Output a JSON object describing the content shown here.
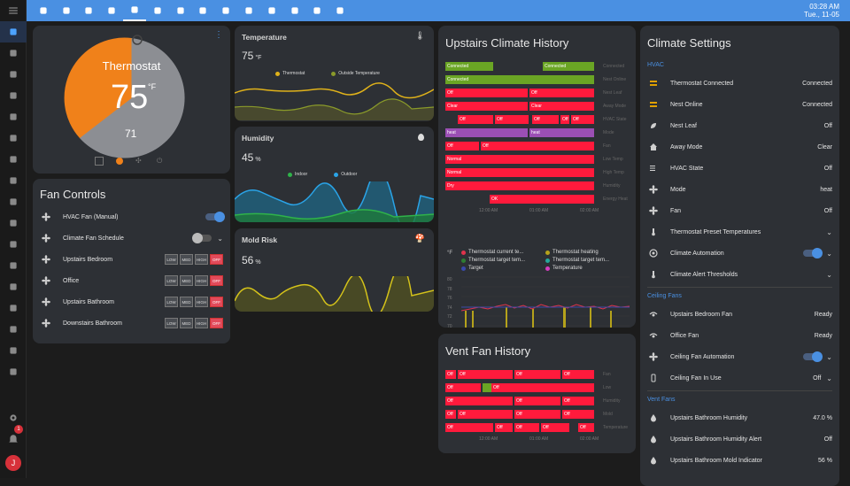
{
  "clock": {
    "time": "03:28 AM",
    "date": "Tue., 11-05"
  },
  "thermostat": {
    "name": "Thermostat",
    "target": "75",
    "unit": "°F",
    "current": "71"
  },
  "sensors": {
    "temperature": {
      "title": "Temperature",
      "value": "75",
      "unit": "°F",
      "legend": [
        "Thermostat",
        "Outside Temperature"
      ]
    },
    "humidity": {
      "title": "Humidity",
      "value": "45",
      "unit": "%",
      "legend": [
        "Indoor",
        "Outdoor"
      ]
    },
    "mold": {
      "title": "Mold Risk",
      "value": "56",
      "unit": "%"
    }
  },
  "fan_controls": {
    "title": "Fan Controls",
    "rows": [
      {
        "name": "HVAC Fan (Manual)",
        "type": "toggle",
        "on": true
      },
      {
        "name": "Climate Fan Schedule",
        "type": "toggle-chev",
        "on": false
      },
      {
        "name": "Upstairs Bedroom",
        "type": "speed"
      },
      {
        "name": "Office",
        "type": "speed"
      },
      {
        "name": "Upstairs Bathroom",
        "type": "speed"
      },
      {
        "name": "Downstairs Bathroom",
        "type": "speed"
      }
    ],
    "speeds": [
      "LOW",
      "MED",
      "HIGH",
      "OFF"
    ]
  },
  "upstairs_history": {
    "title": "Upstairs Climate History",
    "rows": [
      {
        "label": "Connected",
        "color": "#6aa524",
        "bars": [
          {
            "t": "Connected",
            "x": 0,
            "w": 54
          },
          {
            "t": "Connected",
            "x": 110,
            "w": 58
          }
        ]
      },
      {
        "label": "Nest Online",
        "color": "#6aa524",
        "bars": [
          {
            "t": "Connected",
            "x": 0,
            "w": 168
          }
        ]
      },
      {
        "label": "Nest Leaf",
        "color": "#ff1a3c",
        "bars": [
          {
            "t": "Off",
            "x": 0,
            "w": 93
          },
          {
            "t": "Off",
            "x": 95,
            "w": 73
          }
        ]
      },
      {
        "label": "Away Mode",
        "color": "#ff1a3c",
        "bars": [
          {
            "t": "Clear",
            "x": 0,
            "w": 93
          },
          {
            "t": "Clear",
            "x": 95,
            "w": 73
          }
        ]
      },
      {
        "label": "HVAC State",
        "color": "#ff1a3c",
        "bars": [
          {
            "t": "Off",
            "x": 14,
            "w": 40
          },
          {
            "t": "Off",
            "x": 56,
            "w": 38
          },
          {
            "t": "Off",
            "x": 98,
            "w": 30
          },
          {
            "t": "Off",
            "x": 130,
            "w": 10
          },
          {
            "t": "Off",
            "x": 142,
            "w": 26
          }
        ]
      },
      {
        "label": "Mode",
        "color": "#9b4fb4",
        "bars": [
          {
            "t": "heat",
            "x": 0,
            "w": 93
          },
          {
            "t": "heat",
            "x": 95,
            "w": 73
          }
        ]
      },
      {
        "label": "Fan",
        "color": "#ff1a3c",
        "bars": [
          {
            "t": "Off",
            "x": 0,
            "w": 38
          },
          {
            "t": "Off",
            "x": 40,
            "w": 128
          }
        ]
      },
      {
        "label": "Low Temp",
        "color": "#ff1a3c",
        "bars": [
          {
            "t": "Normal",
            "x": 0,
            "w": 168
          }
        ]
      },
      {
        "label": "High Temp",
        "color": "#ff1a3c",
        "bars": [
          {
            "t": "Normal",
            "x": 0,
            "w": 168
          }
        ]
      },
      {
        "label": "Humidity",
        "color": "#ff1a3c",
        "bars": [
          {
            "t": "Dry",
            "x": 0,
            "w": 168
          }
        ]
      },
      {
        "label": "Energy Heat",
        "color": "#ff1a3c",
        "bars": [
          {
            "t": "OK",
            "x": 50,
            "w": 118
          }
        ]
      }
    ],
    "times": [
      "12:00 AM",
      "01:00 AM",
      "02:00 AM"
    ],
    "unit": "°F",
    "legend": [
      {
        "t": "Thermostat current te...",
        "c": "#e0334c"
      },
      {
        "t": "Thermostat heating",
        "c": "#b5a21b"
      },
      {
        "t": "Thermostat target tem...",
        "c": "#2e7d32"
      },
      {
        "t": "Thermostat target tem...",
        "c": "#26a69a"
      },
      {
        "t": "Target",
        "c": "#3949ab"
      },
      {
        "t": "Temperature",
        "c": "#d63dc0"
      }
    ],
    "yticks": [
      "80",
      "78",
      "76",
      "74",
      "72",
      "70",
      "68"
    ]
  },
  "vent_history": {
    "title": "Vent Fan History",
    "rows": [
      {
        "label": "Fan",
        "bars": [
          {
            "t": "Off",
            "x": 0,
            "w": 12
          },
          {
            "t": "Off",
            "x": 14,
            "w": 62
          },
          {
            "t": "Off",
            "x": 78,
            "w": 52
          },
          {
            "t": "Off",
            "x": 132,
            "w": 36
          }
        ]
      },
      {
        "label": "Low",
        "bars": [
          {
            "t": "Off",
            "x": 0,
            "w": 40
          },
          {
            "t": "",
            "x": 42,
            "w": 10,
            "c": "#6aa524"
          },
          {
            "t": "Off",
            "x": 52,
            "w": 116
          }
        ]
      },
      {
        "label": "Humidity",
        "bars": [
          {
            "t": "Off",
            "x": 0,
            "w": 76
          },
          {
            "t": "Off",
            "x": 78,
            "w": 52
          },
          {
            "t": "Off",
            "x": 132,
            "w": 36
          }
        ]
      },
      {
        "label": "Mold",
        "bars": [
          {
            "t": "Off",
            "x": 0,
            "w": 12
          },
          {
            "t": "Off",
            "x": 14,
            "w": 62
          },
          {
            "t": "Off",
            "x": 78,
            "w": 52
          },
          {
            "t": "Off",
            "x": 132,
            "w": 36
          }
        ]
      },
      {
        "label": "Temperature",
        "bars": [
          {
            "t": "Off",
            "x": 0,
            "w": 54
          },
          {
            "t": "Off",
            "x": 56,
            "w": 20
          },
          {
            "t": "Off",
            "x": 78,
            "w": 28
          },
          {
            "t": "Off",
            "x": 108,
            "w": 32
          },
          {
            "t": "Off",
            "x": 150,
            "w": 18
          }
        ]
      }
    ],
    "times": [
      "12:00 AM",
      "01:00 AM",
      "02:00 AM"
    ]
  },
  "climate_settings": {
    "title": "Climate Settings",
    "sections": [
      {
        "name": "HVAC",
        "rows": [
          {
            "name": "Thermostat Connected",
            "val": "Connected",
            "icon": "bar"
          },
          {
            "name": "Nest Online",
            "val": "Connected",
            "icon": "bar"
          },
          {
            "name": "Nest Leaf",
            "val": "Off",
            "icon": "leaf"
          },
          {
            "name": "Away Mode",
            "val": "Clear",
            "icon": "home"
          },
          {
            "name": "HVAC State",
            "val": "Off",
            "icon": "list"
          },
          {
            "name": "Mode",
            "val": "heat",
            "icon": "fan"
          },
          {
            "name": "Fan",
            "val": "Off",
            "icon": "fan"
          },
          {
            "name": "Thermostat Preset Temperatures",
            "val": "",
            "icon": "therm",
            "chev": true
          },
          {
            "name": "Climate Automation",
            "val": "",
            "icon": "auto",
            "toggle": true,
            "chev": true
          },
          {
            "name": "Climate Alert Thresholds",
            "val": "",
            "icon": "therm",
            "chev": true
          }
        ]
      },
      {
        "name": "Ceiling Fans",
        "rows": [
          {
            "name": "Upstairs Bedroom Fan",
            "val": "Ready",
            "icon": "ceil"
          },
          {
            "name": "Office Fan",
            "val": "Ready",
            "icon": "ceil"
          },
          {
            "name": "Ceiling Fan Automation",
            "val": "",
            "icon": "fan",
            "toggle": true,
            "chev": true
          },
          {
            "name": "Ceiling Fan In Use",
            "val": "Off",
            "icon": "remote",
            "chev": true
          }
        ]
      },
      {
        "name": "Vent Fans",
        "rows": [
          {
            "name": "Upstairs Bathroom Humidity",
            "val": "47.0 %",
            "icon": "drop"
          },
          {
            "name": "Upstairs Bathroom Humidity Alert",
            "val": "Off",
            "icon": "drop"
          },
          {
            "name": "Upstairs Bathroom Mold Indicator",
            "val": "56 %",
            "icon": "drop"
          }
        ]
      }
    ]
  },
  "sidebar_badge": "1",
  "user_initial": "J"
}
